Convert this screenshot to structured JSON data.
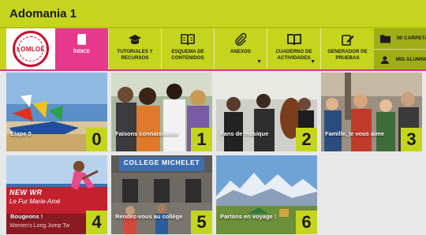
{
  "app": {
    "title": "Adomania 1"
  },
  "logo": {
    "text": "LOMLOE",
    "ring_text": "Nouveaux contenus"
  },
  "toolbar": {
    "items": [
      {
        "label": "Índice",
        "icon": "book-icon",
        "active": true
      },
      {
        "label": "Tutoriales y recursos",
        "icon": "graduation-cap-icon"
      },
      {
        "label": "Esquema de contenidos",
        "icon": "open-book-icon"
      },
      {
        "label": "Anexos",
        "icon": "paperclip-icon",
        "dropdown": true
      },
      {
        "label": "Cuaderno de actividades",
        "icon": "notebook-icon",
        "dropdown": true
      },
      {
        "label": "Generador de pruebas",
        "icon": "edit-icon"
      }
    ]
  },
  "side": {
    "folder_label": "MI CARPETA",
    "students_label": "MIS ALUMNOS"
  },
  "tiles": [
    {
      "caption": "Étape 0",
      "number": "0"
    },
    {
      "caption": "Faisons connaissance",
      "number": "1"
    },
    {
      "caption": "Fans de musique",
      "number": "2"
    },
    {
      "caption": "Famille, je vous aime",
      "number": "3"
    },
    {
      "caption": "Bougeons !",
      "number": "4",
      "sign_top": "NEW WR",
      "sign_mid": "Le Fur Marie-Amé",
      "sign_bottom": "Women's Long Jump Tw"
    },
    {
      "caption": "Rendez-vous au collège",
      "number": "5",
      "sign_top": "COLLEGE MICHELET"
    },
    {
      "caption": "Partons en voyage !",
      "number": "6"
    }
  ],
  "colors": {
    "accent": "#c5d51e",
    "pink": "#e6388d",
    "logo_red": "#c8102e"
  }
}
